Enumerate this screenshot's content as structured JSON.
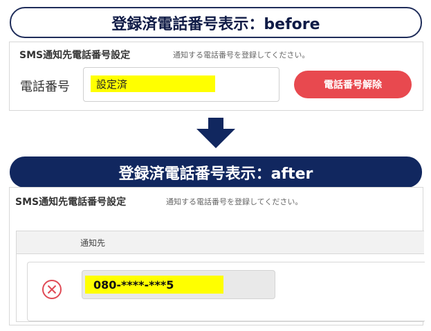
{
  "before": {
    "banner": "登録済電話番号表示：before",
    "section_title": "SMS通知先電話番号設定",
    "section_desc": "通知する電話番号を登録してください。",
    "phone_label": "電話番号",
    "phone_value": "設定済",
    "unset_button": "電話番号解除"
  },
  "arrow_icon": "down-arrow-icon",
  "after": {
    "banner": "登録済電話番号表示：after",
    "section_title": "SMS通知先電話番号設定",
    "section_desc": "通知する電話番号を登録してください。",
    "column_header": "通知先",
    "delete_icon": "close-circle-icon",
    "phone_masked": "080-****-***5"
  },
  "colors": {
    "navy": "#11275f",
    "red_button": "#e8494f",
    "highlight": "#ffff00",
    "delete_icon": "#e04a55"
  }
}
